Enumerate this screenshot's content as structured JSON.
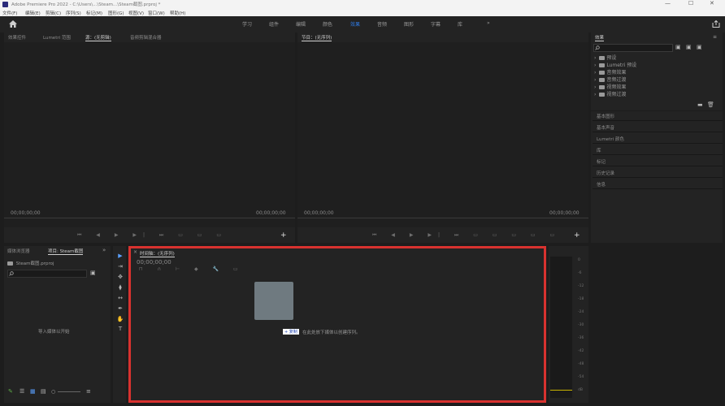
{
  "window": {
    "title": "Adobe Premiere Pro 2022 - C:\\Users\\...\\Steam...\\Steam截图.prproj *",
    "minimize": "—",
    "maximize": "☐",
    "close": "✕"
  },
  "menu": [
    "文件(F)",
    "编辑(E)",
    "剪辑(C)",
    "序列(S)",
    "标记(M)",
    "图形(G)",
    "视图(V)",
    "窗口(W)",
    "帮助(H)"
  ],
  "workspaces": {
    "home_icon": "home-icon",
    "tabs": [
      "学习",
      "组件",
      "编辑",
      "颜色",
      "效果",
      "音频",
      "图形",
      "字幕",
      "库"
    ],
    "active": "效果",
    "more": "»",
    "export_icon": "export-icon"
  },
  "source_panel": {
    "tabs": [
      "效果控件",
      "Lumetri 范围",
      "源：(无剪辑)",
      "音频剪辑混合器"
    ],
    "active_tab": "源：(无剪辑)",
    "timecode_left": "00;00;00;00",
    "timecode_right": "00;00;00;00",
    "add_button": "+"
  },
  "program_panel": {
    "tab": "节目：(无序列)",
    "timecode_left": "00;00;00;00",
    "timecode_right": "00;00;00;00",
    "add_button": "+"
  },
  "effects_panel": {
    "title": "效果",
    "menu": "≡",
    "search_placeholder": "",
    "tree": [
      "预设",
      "Lumetri 预设",
      "音频效果",
      "音频过渡",
      "视频效果",
      "视频过渡"
    ],
    "sections": [
      "基本图形",
      "基本声音",
      "Lumetri 颜色",
      "库",
      "标记",
      "历史记录",
      "信息"
    ]
  },
  "project_panel": {
    "tabs": [
      "媒体浏览器",
      "项目: Steam截图"
    ],
    "active_tab": "项目: Steam截图",
    "more": "»",
    "project_file": "Steam截图.prproj",
    "empty_text": "导入媒体以开始"
  },
  "tools": [
    "▶",
    "⇥",
    "✥",
    "⧫",
    "↔",
    "✒",
    "✋",
    "T"
  ],
  "timeline": {
    "tab": "时间轴：(无序列)",
    "timecode": "00;00;00;00",
    "drop_badge": "+ 复制",
    "drop_hint": "在此处放下媒体以创建序列。"
  },
  "audio_meter": {
    "scale": [
      "0",
      "-6",
      "-12",
      "-18",
      "-24",
      "-30",
      "-36",
      "-42",
      "-48",
      "-54",
      "dB"
    ]
  },
  "colors": {
    "highlight": "#d8322f",
    "active_workspace": "#2e7be6",
    "tool_accent": "#5aa0ff"
  }
}
